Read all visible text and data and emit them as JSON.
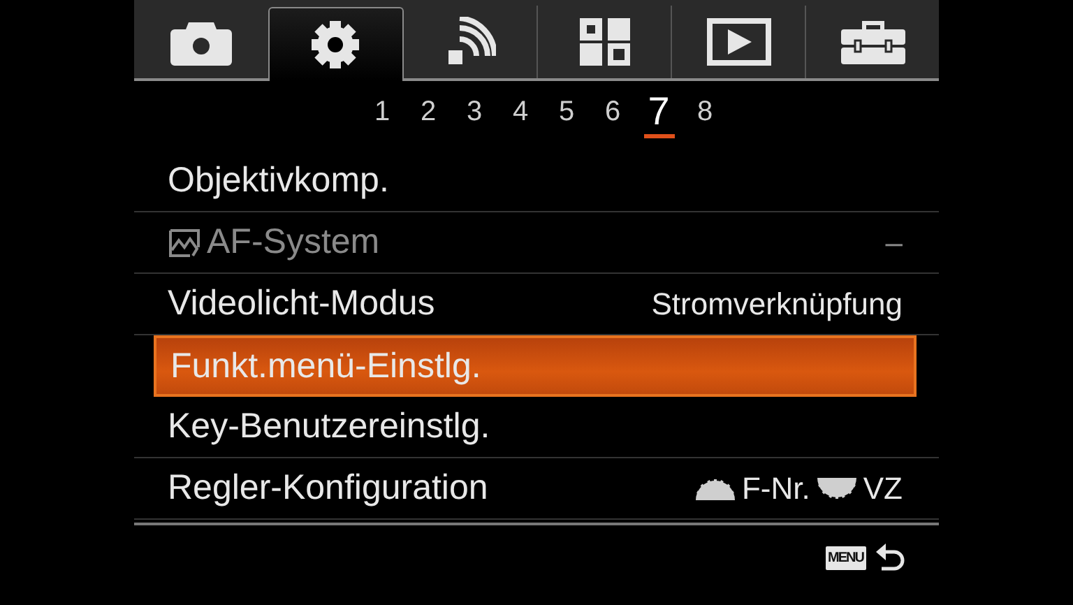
{
  "tabs": [
    {
      "kind": "camera",
      "selected": false
    },
    {
      "kind": "gear",
      "selected": true
    },
    {
      "kind": "wireless",
      "selected": false
    },
    {
      "kind": "grid",
      "selected": false
    },
    {
      "kind": "playback",
      "selected": false
    },
    {
      "kind": "toolbox",
      "selected": false
    }
  ],
  "pages": [
    {
      "label": "1",
      "selected": false
    },
    {
      "label": "2",
      "selected": false
    },
    {
      "label": "3",
      "selected": false
    },
    {
      "label": "4",
      "selected": false
    },
    {
      "label": "5",
      "selected": false
    },
    {
      "label": "6",
      "selected": false
    },
    {
      "label": "7",
      "selected": true
    },
    {
      "label": "8",
      "selected": false
    }
  ],
  "rows": [
    {
      "label": "Objektivkomp.",
      "image_icon": false,
      "selected": false,
      "disabled": false
    },
    {
      "label": "AF-System",
      "image_icon": true,
      "value": "–",
      "selected": false,
      "disabled": true
    },
    {
      "label": "Videolicht-Modus",
      "image_icon": false,
      "value": "Stromverknüpfung",
      "selected": false,
      "disabled": false
    },
    {
      "label": "Funkt.menü-Einstlg.",
      "image_icon": false,
      "selected": true,
      "disabled": false
    },
    {
      "label": "Key-Benutzereinstlg.",
      "image_icon": false,
      "selected": false,
      "disabled": false
    },
    {
      "label": "Regler-Konfiguration",
      "image_icon": false,
      "value_parts": [
        {
          "kind": "front-dial",
          "text": "F-Nr."
        },
        {
          "kind": "rear-dial",
          "text": "VZ"
        }
      ],
      "selected": false,
      "disabled": false
    }
  ],
  "footer": {
    "menu_label": "MENU"
  }
}
